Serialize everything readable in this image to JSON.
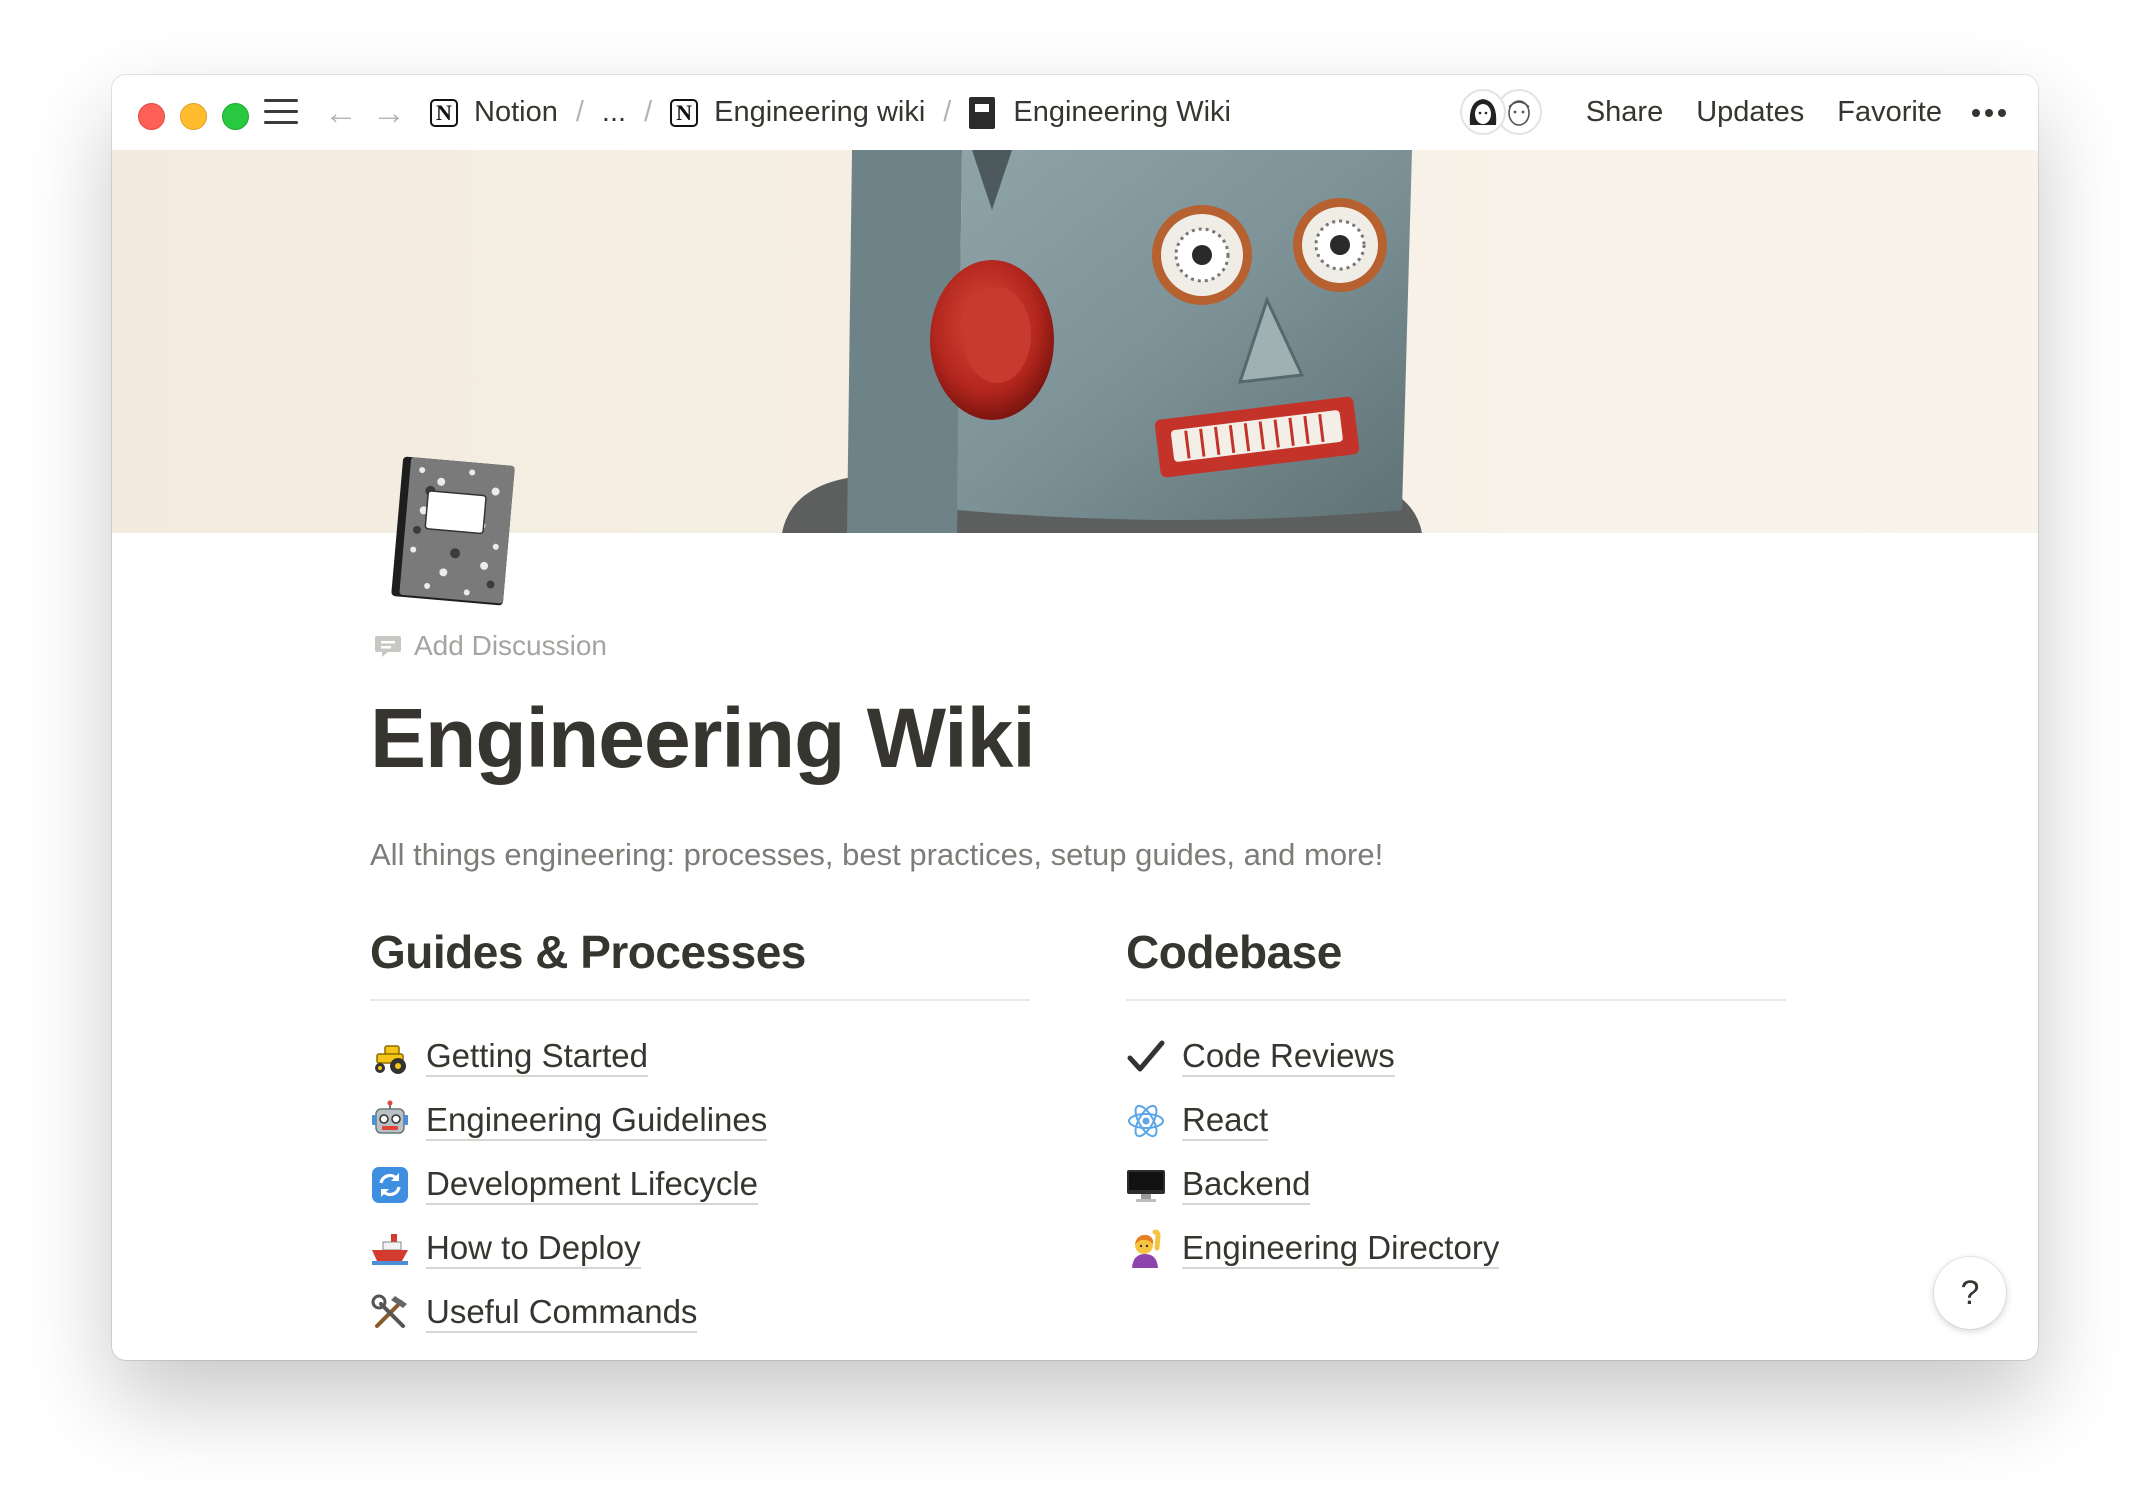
{
  "titlebar": {
    "breadcrumbs": [
      "Notion",
      "...",
      "Engineering wiki",
      "Engineering Wiki"
    ],
    "separator": "/",
    "actions": {
      "share": "Share",
      "updates": "Updates",
      "favorite": "Favorite"
    }
  },
  "page": {
    "add_discussion": "Add Discussion",
    "title": "Engineering Wiki",
    "description": "All things engineering: processes, best practices, setup guides, and more!"
  },
  "columns": [
    {
      "heading": "Guides & Processes",
      "items": [
        {
          "label": "Getting Started",
          "icon": "tractor-icon"
        },
        {
          "label": "Engineering Guidelines",
          "icon": "robot-icon"
        },
        {
          "label": "Development Lifecycle",
          "icon": "cycle-arrows-icon"
        },
        {
          "label": "How to Deploy",
          "icon": "ship-icon"
        },
        {
          "label": "Useful Commands",
          "icon": "tools-icon"
        }
      ]
    },
    {
      "heading": "Codebase",
      "items": [
        {
          "label": "Code Reviews",
          "icon": "checkmark-icon"
        },
        {
          "label": "React",
          "icon": "atom-icon"
        },
        {
          "label": "Backend",
          "icon": "desktop-computer-icon"
        },
        {
          "label": "Engineering Directory",
          "icon": "person-raising-hand-icon"
        }
      ]
    }
  ],
  "help": {
    "label": "?"
  },
  "colors": {
    "text": "#37352f",
    "muted": "#7d7c78",
    "traffic_red": "#fe5f57",
    "traffic_yellow": "#febc2e",
    "traffic_green": "#28c840"
  }
}
